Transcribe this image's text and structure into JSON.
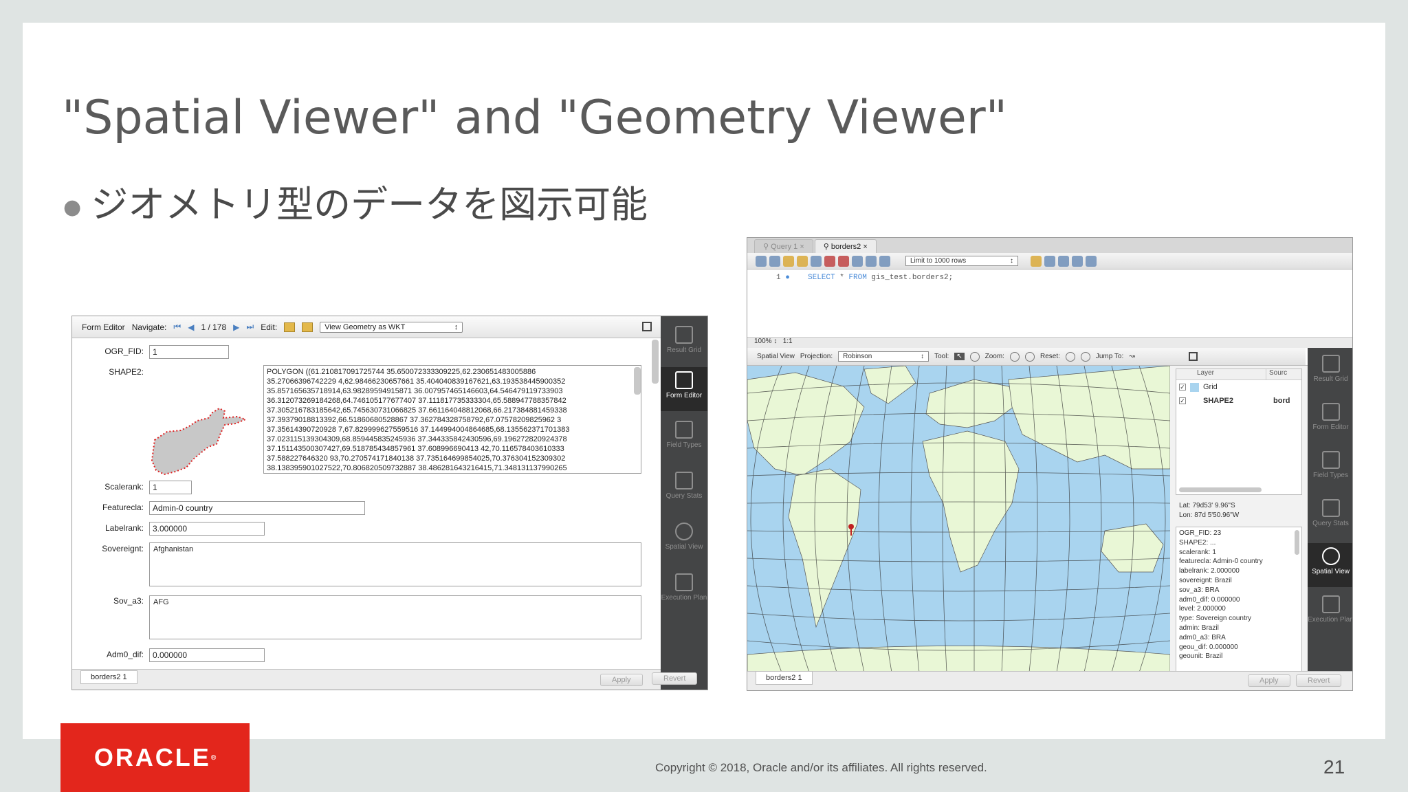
{
  "slide": {
    "title": "\"Spatial Viewer\" and \"Geometry Viewer\"",
    "bullet": "ジオメトリ型のデータを図示可能",
    "logo": "ORACLE",
    "copyright": "Copyright © 2018, Oracle and/or its affiliates. All rights reserved.",
    "page_number": "21"
  },
  "form_editor": {
    "toolbar": {
      "title": "Form Editor",
      "navigate_label": "Navigate:",
      "record_position": "1 / 178",
      "edit_label": "Edit:",
      "view_mode": "View Geometry as WKT"
    },
    "fields": {
      "ogr_fid_label": "OGR_FID:",
      "ogr_fid_value": "1",
      "shape2_label": "SHAPE2:",
      "shape2_wkt": "POLYGON ((61.210817091725744 35.650072333309225,62.230651483005886\n35.27066396742229 4,62.98466230657661 35.404040839167621,63.193538445900352\n35.857165635718914,63.98289594915871 36.007957465146603,64.546479119733903\n36.312073269184268,64.746105177677407 37.111817735333304,65.588947788357842\n37.305216783185642,65.745630731066825 37.661164048812068,66.217384881459338\n37.39379018813392,66.51860680528867 37.362784328758792,67.07578209825962 3\n37.35614390720928 7,67.829999627559516 37.144994004864685,68.135562371701383\n37.023115139304309,68.859445835245936 37.344335842430596,69.196272820924378\n37.151143500307427,69.518785434857961 37.608996690413 42,70.116578403610333\n37.588227646320 93,70.270574171840138 37.735164699854025,70.376304152309302\n38.138395901027522,70.806820509732887 38.486281643216415,71.348131137990265",
      "scalerank_label": "Scalerank:",
      "scalerank_value": "1",
      "featurecla_label": "Featurecla:",
      "featurecla_value": "Admin-0 country",
      "labelrank_label": "Labelrank:",
      "labelrank_value": "3.000000",
      "sovereignt_label": "Sovereignt:",
      "sovereignt_value": "Afghanistan",
      "sov_a3_label": "Sov_a3:",
      "sov_a3_value": "AFG",
      "adm0_dif_label": "Adm0_dif:",
      "adm0_dif_value": "0.000000"
    },
    "sidebar": [
      {
        "label": "Result Grid",
        "active": false
      },
      {
        "label": "Form Editor",
        "active": true
      },
      {
        "label": "Field Types",
        "active": false
      },
      {
        "label": "Query Stats",
        "active": false
      },
      {
        "label": "Spatial View",
        "active": false
      },
      {
        "label": "Execution Plan",
        "active": false
      }
    ],
    "bottom_tab": "borders2 1",
    "apply_label": "Apply",
    "revert_label": "Revert"
  },
  "workbench": {
    "tabs": [
      "Query 1",
      "borders2"
    ],
    "active_tab": "borders2",
    "limit_rows": "Limit to 1000 rows",
    "sql_line_number": "1",
    "sql": {
      "kw1": "SELECT",
      "star": " * ",
      "kw2": "FROM",
      "rest": " gis_test.borders2;"
    },
    "zoom_level": "100%",
    "zoom_ratio": "1:1",
    "spatial_toolbar": {
      "view_label": "Spatial View",
      "projection_label": "Projection:",
      "projection_value": "Robinson",
      "tool_label": "Tool:",
      "zoom_label": "Zoom:",
      "reset_label": "Reset:",
      "jump_label": "Jump To:"
    },
    "layers": {
      "col_layer": "Layer",
      "col_source": "Sourc",
      "rows": [
        {
          "name": "Grid",
          "source": "",
          "checked": true
        },
        {
          "name": "SHAPE2",
          "source": "bord",
          "checked": true
        }
      ]
    },
    "lat": "Lat:  79d53' 9.96\"S",
    "lon": "Lon:  87d 5'50.96\"W",
    "properties": [
      "OGR_FID: 23",
      "SHAPE2: ...",
      "scalerank: 1",
      "featurecla: Admin-0 country",
      "labelrank: 2.000000",
      "sovereignt: Brazil",
      "sov_a3: BRA",
      "adm0_dif: 0.000000",
      "level: 2.000000",
      "type: Sovereign country",
      "admin: Brazil",
      "adm0_a3: BRA",
      "geou_dif: 0.000000",
      "geounit: Brazil"
    ],
    "sidebar": [
      {
        "label": "Result Grid",
        "active": false
      },
      {
        "label": "Form Editor",
        "active": false
      },
      {
        "label": "Field Types",
        "active": false
      },
      {
        "label": "Query Stats",
        "active": false
      },
      {
        "label": "Spatial View",
        "active": true
      },
      {
        "label": "Execution Plan",
        "active": false
      }
    ],
    "bottom_tab": "borders2 1",
    "apply_label": "Apply",
    "revert_label": "Revert"
  },
  "colors": {
    "oracle_red": "#e3261c",
    "ocean": "#a9d4ef",
    "land": "#e9f7d6",
    "sidebar_dark": "#444546"
  }
}
